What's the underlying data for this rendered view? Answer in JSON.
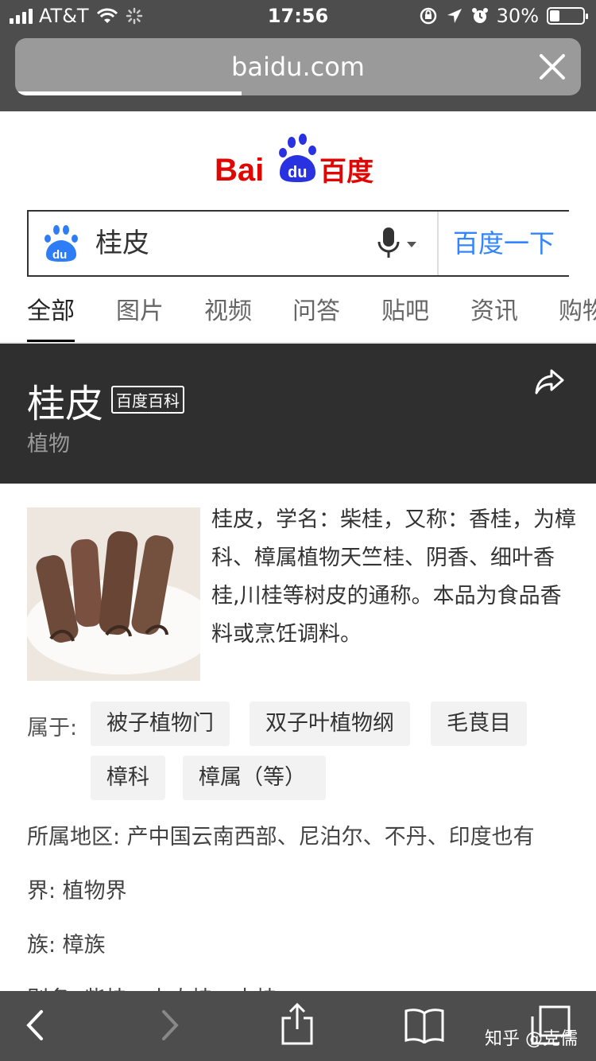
{
  "status_bar": {
    "carrier": "AT&T",
    "time": "17:56",
    "battery": "30%"
  },
  "browser": {
    "url": "baidu.com",
    "load_progress": 0.4
  },
  "logo": {
    "text_bai": "Bai",
    "text_du": "du",
    "text_cn": "百度"
  },
  "search": {
    "query": "桂皮",
    "button": "百度一下"
  },
  "tabs": [
    "全部",
    "图片",
    "视频",
    "问答",
    "贴吧",
    "资讯",
    "购物"
  ],
  "result": {
    "title": "桂皮",
    "badge": "百度百科",
    "subtitle": "植物",
    "description": "桂皮，学名：柴桂，又称：香桂，为樟科、樟属植物天竺桂、阴香、细叶香桂,川桂等树皮的通称。本品为食品香料或烹饪调料。",
    "category_label": "属于:",
    "categories": [
      "被子植物门",
      "双子叶植物纲",
      "毛茛目",
      "樟科",
      "樟属（等）"
    ],
    "info": [
      "所属地区: 产中国云南西部、尼泊尔、不丹、印度也有",
      "界: 植物界",
      "族: 樟族",
      "别名: 柴桂、山肉桂、土桂"
    ]
  },
  "watermark": "知乎 @克儒",
  "colors": {
    "baidu_red": "#e10601",
    "baidu_blue": "#2932e1",
    "link_blue": "#3385ff"
  }
}
